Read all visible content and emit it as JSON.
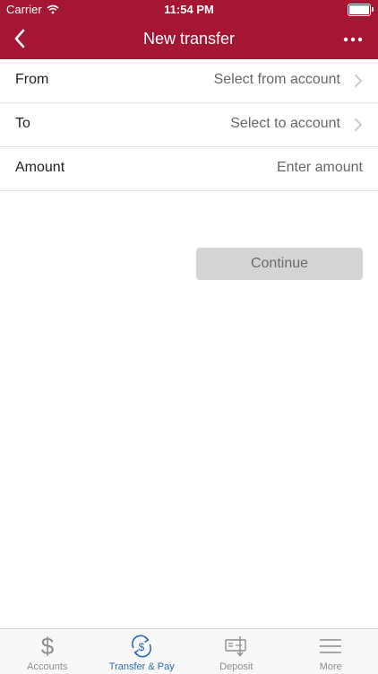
{
  "status_bar": {
    "carrier": "Carrier",
    "time": "11:54 PM"
  },
  "nav": {
    "title": "New transfer",
    "back_icon": "chevron-left-icon",
    "more_icon": "ellipsis-icon"
  },
  "form": {
    "from": {
      "label": "From",
      "value": "Select from account"
    },
    "to": {
      "label": "To",
      "value": "Select to account"
    },
    "amount": {
      "label": "Amount",
      "placeholder": "Enter amount"
    }
  },
  "actions": {
    "continue_label": "Continue"
  },
  "tabs": [
    {
      "label": "Accounts",
      "icon": "dollar-icon",
      "active": false
    },
    {
      "label": "Transfer & Pay",
      "icon": "transfer-dollar-icon",
      "active": true
    },
    {
      "label": "Deposit",
      "icon": "check-deposit-icon",
      "active": false
    },
    {
      "label": "More",
      "icon": "menu-icon",
      "active": false
    }
  ],
  "colors": {
    "brand": "#a51534",
    "active_tab": "#2b6cb0",
    "disabled_button": "#d4d4d4"
  }
}
